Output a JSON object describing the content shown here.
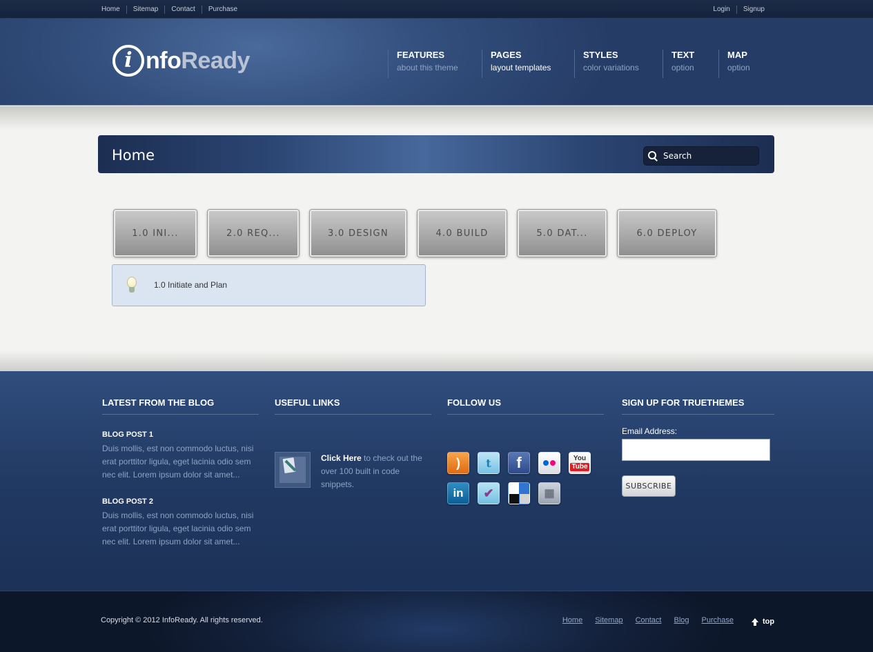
{
  "topbar": {
    "left_links": [
      "Home",
      "Sitemap",
      "Contact",
      "Purchase"
    ],
    "right_links": [
      "Login",
      "Signup"
    ]
  },
  "logo": {
    "mark": "i",
    "part1": "nfo",
    "part2": "Ready"
  },
  "nav": [
    {
      "title": "FEATURES",
      "sub": "about this theme"
    },
    {
      "title": "PAGES",
      "sub": "layout templates"
    },
    {
      "title": "STYLES",
      "sub": "color variations"
    },
    {
      "title": "TEXT",
      "sub": "option"
    },
    {
      "title": "MAP",
      "sub": "option"
    }
  ],
  "page": {
    "title": "Home",
    "search_placeholder": "Search"
  },
  "tabs": [
    "1.0 INI...",
    "2.0 REQ...",
    "3.0 DESIGN",
    "4.0 BUILD",
    "5.0 DAT...",
    "6.0 DEPLOY"
  ],
  "tab_panel": {
    "text": "1.0 Initiate and Plan",
    "icon": "lightbulb-icon"
  },
  "footer": {
    "blog": {
      "heading": "LATEST FROM THE BLOG",
      "posts": [
        {
          "title": "BLOG POST 1",
          "text": "Duis mollis, est non commodo luctus, nisi erat porttitor ligula, eget lacinia odio sem nec elit. Lorem ipsum dolor sit amet..."
        },
        {
          "title": "BLOG POST 2",
          "text": "Duis mollis, est non commodo luctus, nisi erat porttitor ligula, eget lacinia odio sem nec elit. Lorem ipsum dolor sit amet..."
        }
      ]
    },
    "links": {
      "heading": "USEFUL LINKS",
      "click_here": "Click Here",
      "rest": " to check out the over 100 built in code snippets."
    },
    "follow": {
      "heading": "FOLLOW US",
      "icons": [
        "rss-icon",
        "twitter-icon",
        "facebook-icon",
        "flickr-icon",
        "youtube-icon",
        "linkedin-icon",
        "foursquare-icon",
        "delicious-icon",
        "digg-icon"
      ]
    },
    "signup": {
      "heading": "SIGN UP FOR TRUETHEMES",
      "email_label": "Email Address:",
      "button": "SUBSCRIBE"
    }
  },
  "bottom": {
    "copyright": "Copyright © 2012 InfoReady. All rights reserved.",
    "links": [
      "Home",
      "Sitemap",
      "Contact",
      "Blog",
      "Purchase"
    ],
    "top": "top"
  },
  "colors": {
    "header": "#34507e",
    "footer": "#243e69",
    "accent_text": "#8ea3c4",
    "panel": "#dbe5f1"
  }
}
